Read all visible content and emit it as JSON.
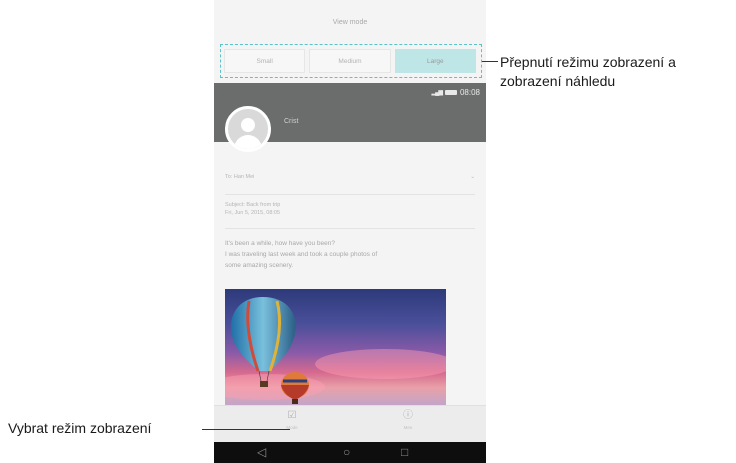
{
  "phone": {
    "view_mode_title": "View mode",
    "tabs": [
      {
        "label": "Small",
        "active": false
      },
      {
        "label": "Medium",
        "active": false
      },
      {
        "label": "Large",
        "active": true
      }
    ],
    "status_time": "08:08",
    "sender": "Crist",
    "email": {
      "to": "To: Han Mei",
      "subject": "Subject: Back from trip",
      "date": "Fri, Jun 5, 2015, 08:05",
      "body_line1": "It's been a while, how have you been?",
      "body_line2": "I was traveling last week and took a couple photos of",
      "body_line3": "some amazing scenery."
    },
    "bottom_bar": [
      {
        "label": "Mode",
        "icon": "checkbox-icon"
      },
      {
        "label": "Mee",
        "icon": "info-icon"
      }
    ],
    "nav_icons": [
      "back-icon",
      "home-icon",
      "recents-icon"
    ]
  },
  "annotations": {
    "top_right_line1": "Přepnutí režimu zobrazení a",
    "top_right_line2": "zobrazení náhledu",
    "bottom_left": "Vybrat režim zobrazení"
  },
  "colors": {
    "accent": "#59c3c8",
    "header": "#6b6d6d"
  }
}
